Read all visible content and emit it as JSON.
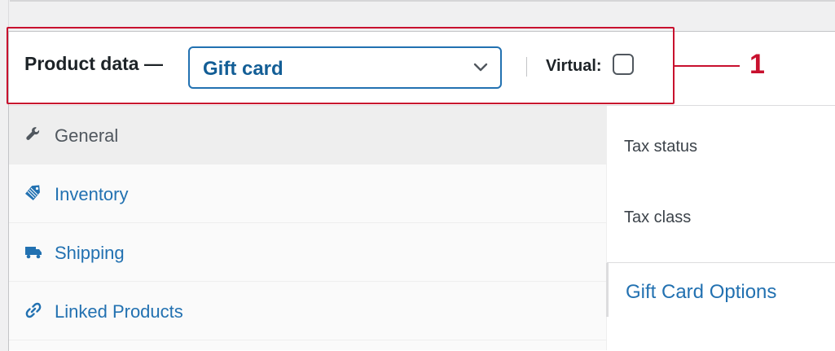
{
  "product_data": {
    "title": "Product data —",
    "product_type": "Gift card",
    "virtual_label": "Virtual:",
    "virtual_checked": false
  },
  "annotation": {
    "number": "1",
    "color": "#c8102e"
  },
  "tabs": [
    {
      "label": "General",
      "icon": "wrench-icon",
      "active": true
    },
    {
      "label": "Inventory",
      "icon": "tag-icon",
      "active": false
    },
    {
      "label": "Shipping",
      "icon": "truck-icon",
      "active": false
    },
    {
      "label": "Linked Products",
      "icon": "link-icon",
      "active": false
    }
  ],
  "general_panel": {
    "tax_status_label": "Tax status",
    "tax_class_label": "Tax class",
    "gift_card_section": "Gift Card Options"
  },
  "colors": {
    "accent": "#2271b1",
    "annotation": "#c8102e"
  }
}
